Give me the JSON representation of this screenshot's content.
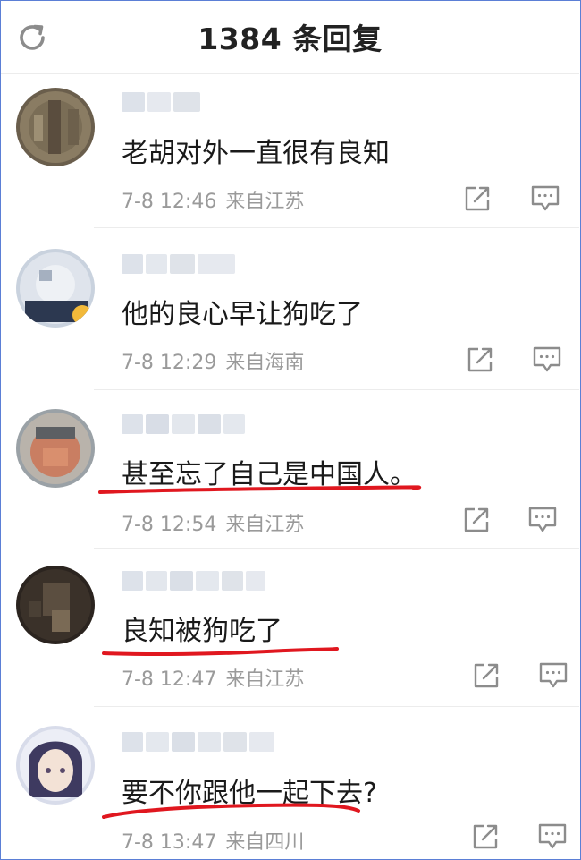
{
  "header": {
    "title": "1384 条回复",
    "refresh_icon": "refresh-icon"
  },
  "colors": {
    "underline": "#e0171f",
    "meta": "#9a9a9a",
    "icon": "#8c8c8c"
  },
  "comments": [
    {
      "text": "老胡对外一直很有良知",
      "time": "7-8 12:46",
      "location": "来自江苏",
      "underlined": false
    },
    {
      "text": "他的良心早让狗吃了",
      "time": "7-8 12:29",
      "location": "来自海南",
      "underlined": false
    },
    {
      "text": "甚至忘了自己是中国人。",
      "time": "7-8 12:54",
      "location": "来自江苏",
      "underlined": true
    },
    {
      "text": "良知被狗吃了",
      "time": "7-8 12:47",
      "location": "来自江苏",
      "underlined": true
    },
    {
      "text": "要不你跟他一起下去?",
      "time": "7-8 13:47",
      "location": "来自四川",
      "underlined": true
    }
  ]
}
